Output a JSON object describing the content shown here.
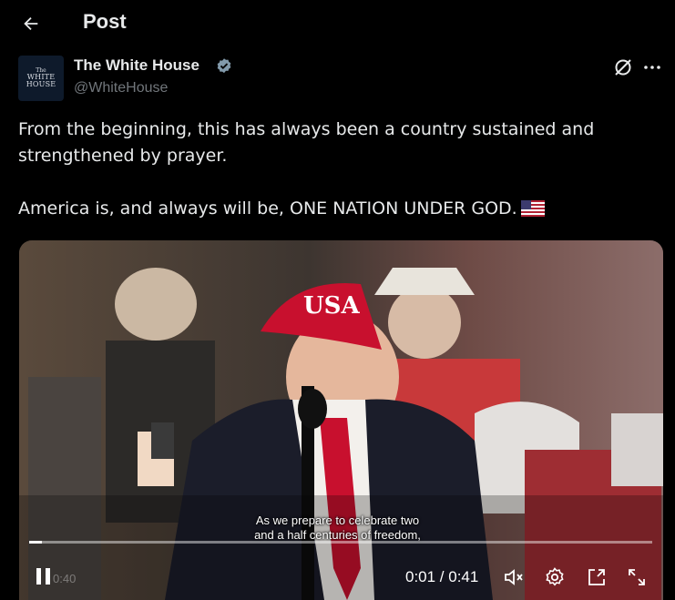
{
  "header": {
    "title": "Post",
    "back_icon": "arrow-left-icon"
  },
  "author": {
    "avatar_text": [
      "The",
      "WHITE",
      "HOUSE"
    ],
    "name": "The White House",
    "handle": "@WhiteHouse",
    "verified_color": "#829aab"
  },
  "post": {
    "paragraph_1": "From the beginning, this has always been a country sustained and strengthened by prayer.",
    "paragraph_2": "America is, and always will be, ONE NATION UNDER GOD.",
    "flag_emoji": "us-flag-icon"
  },
  "video": {
    "caption_line_1": "As we prepare to celebrate two",
    "caption_line_2": "and a half centuries of freedom,",
    "hat_text": "USA",
    "time": "0:01 / 0:41",
    "progress": 0.02,
    "watermark": "0:40"
  },
  "colors": {
    "background": "#000000",
    "text": "#e7e9ea",
    "muted": "#71767b",
    "hat": "#c8102e"
  }
}
